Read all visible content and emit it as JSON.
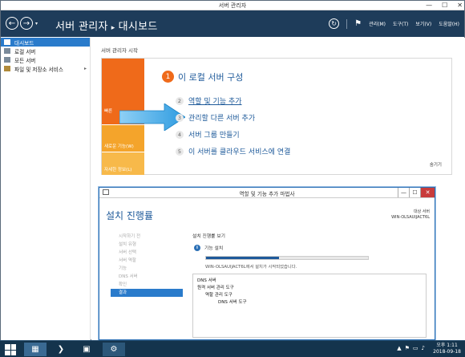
{
  "window": {
    "title": "서버 관리자",
    "minimize": "—",
    "maximize": "☐",
    "close": "✕"
  },
  "header": {
    "back_icon": "←",
    "forward_icon": "→",
    "dropdown_icon": "▾",
    "app_name": "서버 관리자",
    "separator": "▸",
    "page": "대시보드",
    "refresh_icon": "↻",
    "flag_icon": "⚑",
    "menu": [
      "관리(M)",
      "도구(T)",
      "보기(V)",
      "도움말(H)"
    ]
  },
  "sidebar": {
    "items": [
      {
        "label": "대시보드",
        "active": true
      },
      {
        "label": "로컬 서버"
      },
      {
        "label": "모든 서버"
      },
      {
        "label": "파일 및 저장소 서비스",
        "chevron": "▸"
      }
    ]
  },
  "welcome": {
    "title": "서버 관리자 시작",
    "tiles": {
      "quick": "빠른",
      "new": "새로운 기능(W)",
      "more": "자세한 정보(L)"
    },
    "section": {
      "number": "1",
      "title": "이 로컬 서버 구성"
    },
    "steps": [
      {
        "num": "2",
        "label": "역할 및 기능 추가"
      },
      {
        "num": "3",
        "label": "관리할 다른 서버 추가"
      },
      {
        "num": "4",
        "label": "서버 그룹 만들기"
      },
      {
        "num": "5",
        "label": "이 서버를 클라우드 서비스에 연결"
      }
    ],
    "hide": "숨기기"
  },
  "wizard": {
    "title": "역할 및 기능 추가 마법사",
    "ctrls": {
      "min": "—",
      "max": "☐",
      "close": "✕"
    },
    "heading": "설치 진행률",
    "target_label": "대상 서버",
    "target_value": "WIN-OLSAUIJACT6L",
    "nav": [
      "시작하기 전",
      "설치 유형",
      "서버 선택",
      "서버 역할",
      "기능",
      "DNS 서버",
      "확인",
      "결과"
    ],
    "active_nav": 7,
    "view_label": "설치 진행률 보기",
    "install_icon": "i",
    "install_text": "기능 설치",
    "progress": 0.45,
    "status": "WIN-OLSAUIJACT6L에서 설치가 시작되었습니다.",
    "list": [
      {
        "text": "DNS 서버",
        "level": 1
      },
      {
        "text": "원격 서버 관리 도구",
        "level": 1
      },
      {
        "text": "역할 관리 도구",
        "level": 2
      },
      {
        "text": "DNS 서버 도구",
        "level": 3
      }
    ]
  },
  "taskbar": {
    "apps": [
      "server-manager-icon",
      "powershell-icon",
      "explorer-icon",
      "wizard-icon"
    ],
    "app_glyphs": [
      "▦",
      "❯",
      "▣",
      "⚙"
    ],
    "tray": [
      "▲",
      "⚑",
      "▭",
      "♪"
    ],
    "time": "오후 1:11",
    "date": "2018-09-18"
  }
}
